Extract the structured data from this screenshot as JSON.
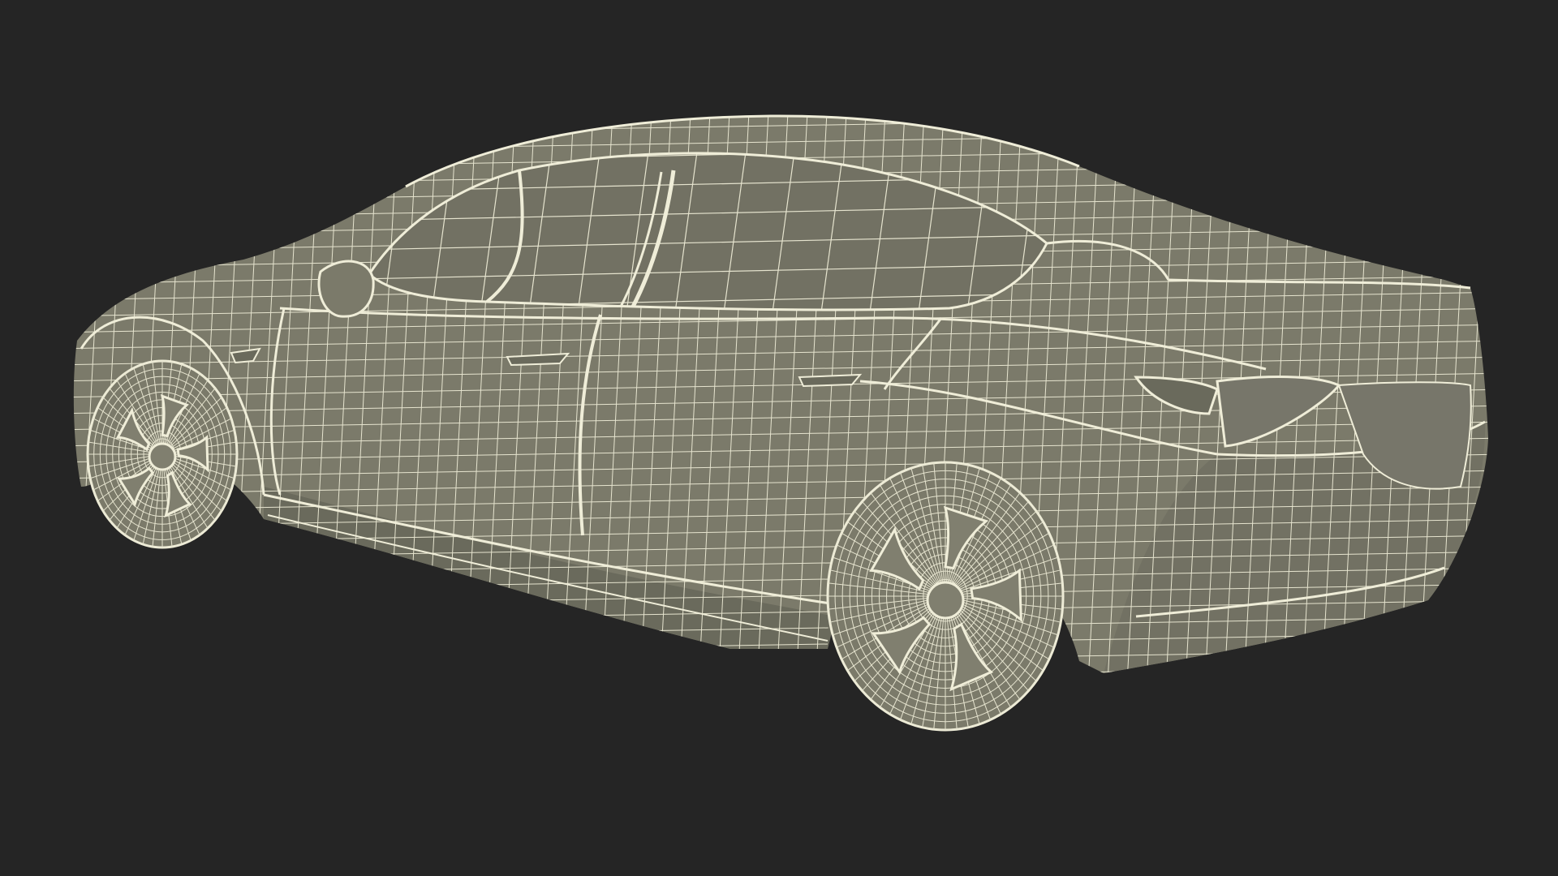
{
  "scene": {
    "subject": "sedan-wireframe-render",
    "background_color": "#252525",
    "surface_color": "#7b7a6a",
    "surface_shadow_color": "#6a6a5c",
    "glass_color": "#727163",
    "wire_color": "#e6e4cf",
    "rim_color": "#807f6f"
  }
}
